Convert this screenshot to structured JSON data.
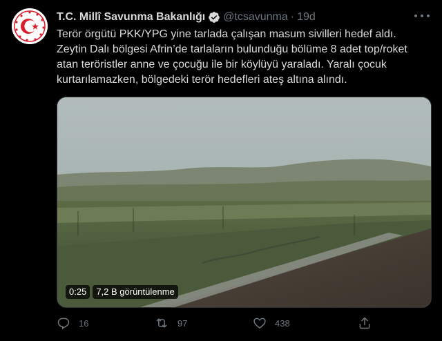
{
  "tweet": {
    "author_name": "T.C. Millî Savunma Bakanlığı",
    "handle": "@tcsavunma",
    "separator": "·",
    "time": "19d",
    "text": "Terör örgütü PKK/YPG yine tarlada çalışan masum sivilleri hedef aldı.\nZeytin Dalı bölgesi Afrin’de tarlaların bulunduğu bölüme 8 adet top/roket\natan teröristler anne ve çocuğu ile bir köylüyü yaraladı. Yaralı çocuk\nkurtarılamazken, bölgedeki terör hedefleri ateş altına alındı.",
    "verified": true
  },
  "media": {
    "duration": "0:25",
    "views": "7,2 B görüntülenme"
  },
  "actions": {
    "replies": "16",
    "retweets": "97",
    "likes": "438"
  },
  "icons": [
    "crescent-star-logo-icon",
    "verified-badge-icon",
    "more-icon",
    "reply-icon",
    "retweet-icon",
    "like-icon",
    "share-icon"
  ],
  "colors": {
    "background": "#000000",
    "text": "#d9d9d9",
    "muted": "#6e767d",
    "verified": "#d9d9d9",
    "logo_red": "#d61f2a"
  }
}
